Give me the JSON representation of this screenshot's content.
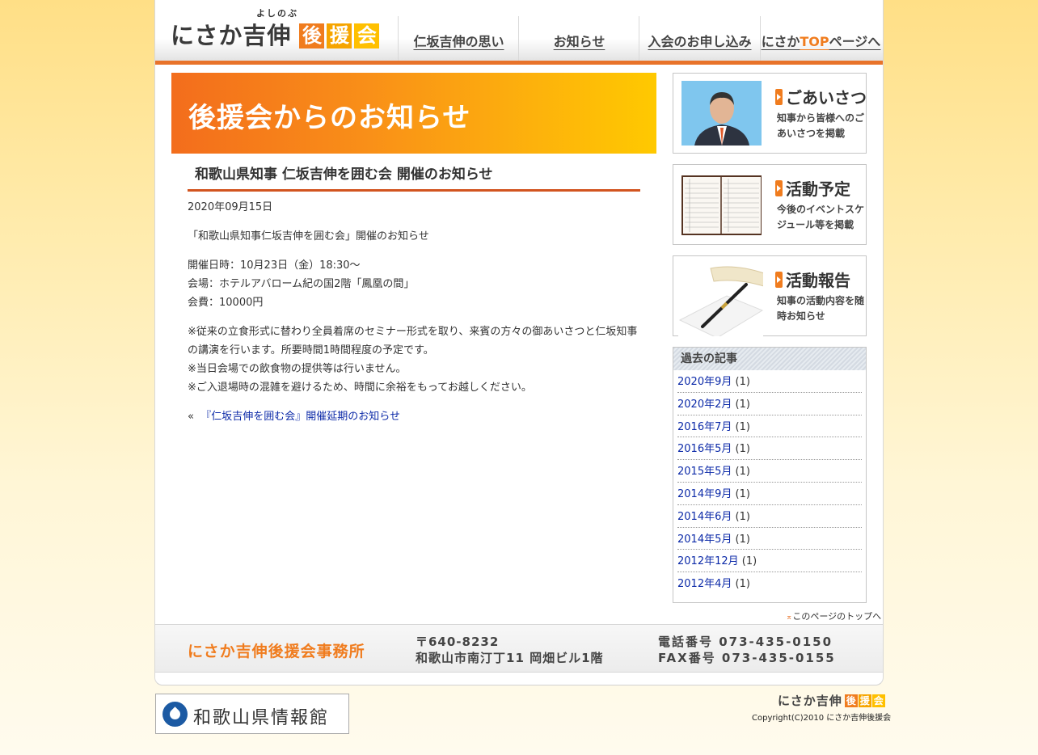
{
  "header": {
    "logo_ruby": "よしのぶ",
    "logo_name": "にさか吉伸",
    "logo_boxes": [
      "後",
      "援",
      "会"
    ],
    "nav": [
      {
        "label": "仁坂吉伸の思い"
      },
      {
        "label": "お知らせ"
      },
      {
        "label": "入会のお申し込み"
      },
      {
        "label_pre": "にさか",
        "label_accent": "TOP",
        "label_post": "ページへ"
      }
    ]
  },
  "main": {
    "banner_title": "後援会からのお知らせ",
    "article": {
      "title": "和歌山県知事 仁坂吉伸を囲む会 開催のお知らせ",
      "date": "2020年09月15日",
      "intro": "「和歌山県知事仁坂吉伸を囲む会」開催のお知らせ",
      "details": [
        "開催日時：10月23日（金）18:30～",
        "会場：ホテルアバローム紀の国2階「鳳凰の間」",
        "会費：10000円"
      ],
      "notes": [
        "※従来の立食形式に替わり全員着席のセミナー形式を取り、来賓の方々の御あいさつと仁坂知事の講演を行います。所要時間1時間程度の予定です。",
        "※当日会場での飲食物の提供等は行いません。",
        "※ご入退場時の混雑を避けるため、時間に余裕をもってお越しください。"
      ],
      "prev_marker": "«",
      "prev_link": "『仁坂吉伸を囲む会』開催延期のお知らせ"
    }
  },
  "sidebar": {
    "banners": [
      {
        "title": "ごあいさつ",
        "desc": "知事から皆様へのごあいさつを掲載"
      },
      {
        "title": "活動予定",
        "desc": "今後のイベントスケジュール等を掲載"
      },
      {
        "title": "活動報告",
        "desc": "知事の活動内容を随時お知らせ"
      }
    ],
    "archive_title": "過去の記事",
    "archive": [
      {
        "label": "2020年9月",
        "count": "(1)"
      },
      {
        "label": "2020年2月",
        "count": "(1)"
      },
      {
        "label": "2016年7月",
        "count": "(1)"
      },
      {
        "label": "2016年5月",
        "count": "(1)"
      },
      {
        "label": "2015年5月",
        "count": "(1)"
      },
      {
        "label": "2014年9月",
        "count": "(1)"
      },
      {
        "label": "2014年6月",
        "count": "(1)"
      },
      {
        "label": "2014年5月",
        "count": "(1)"
      },
      {
        "label": "2012年12月",
        "count": "(1)"
      },
      {
        "label": "2012年4月",
        "count": "(1)"
      }
    ],
    "page_top": "このページのトップへ"
  },
  "footer": {
    "office": "にさか吉伸後援会事務所",
    "postal": "〒640-8232",
    "address": "和歌山市南汀丁11 岡畑ビル1階",
    "tel": "電話番号 073-435-0150",
    "fax": "FAX番号 073-435-0155"
  },
  "bottom": {
    "info_banner": "和歌山県情報館",
    "logo_name": "にさか吉伸",
    "copyright": "Copyright(C)2010 にさか吉伸後援会"
  },
  "colors": {
    "accent": "#f07c1e",
    "link": "#0c2aa8",
    "rule": "#d2541f"
  }
}
